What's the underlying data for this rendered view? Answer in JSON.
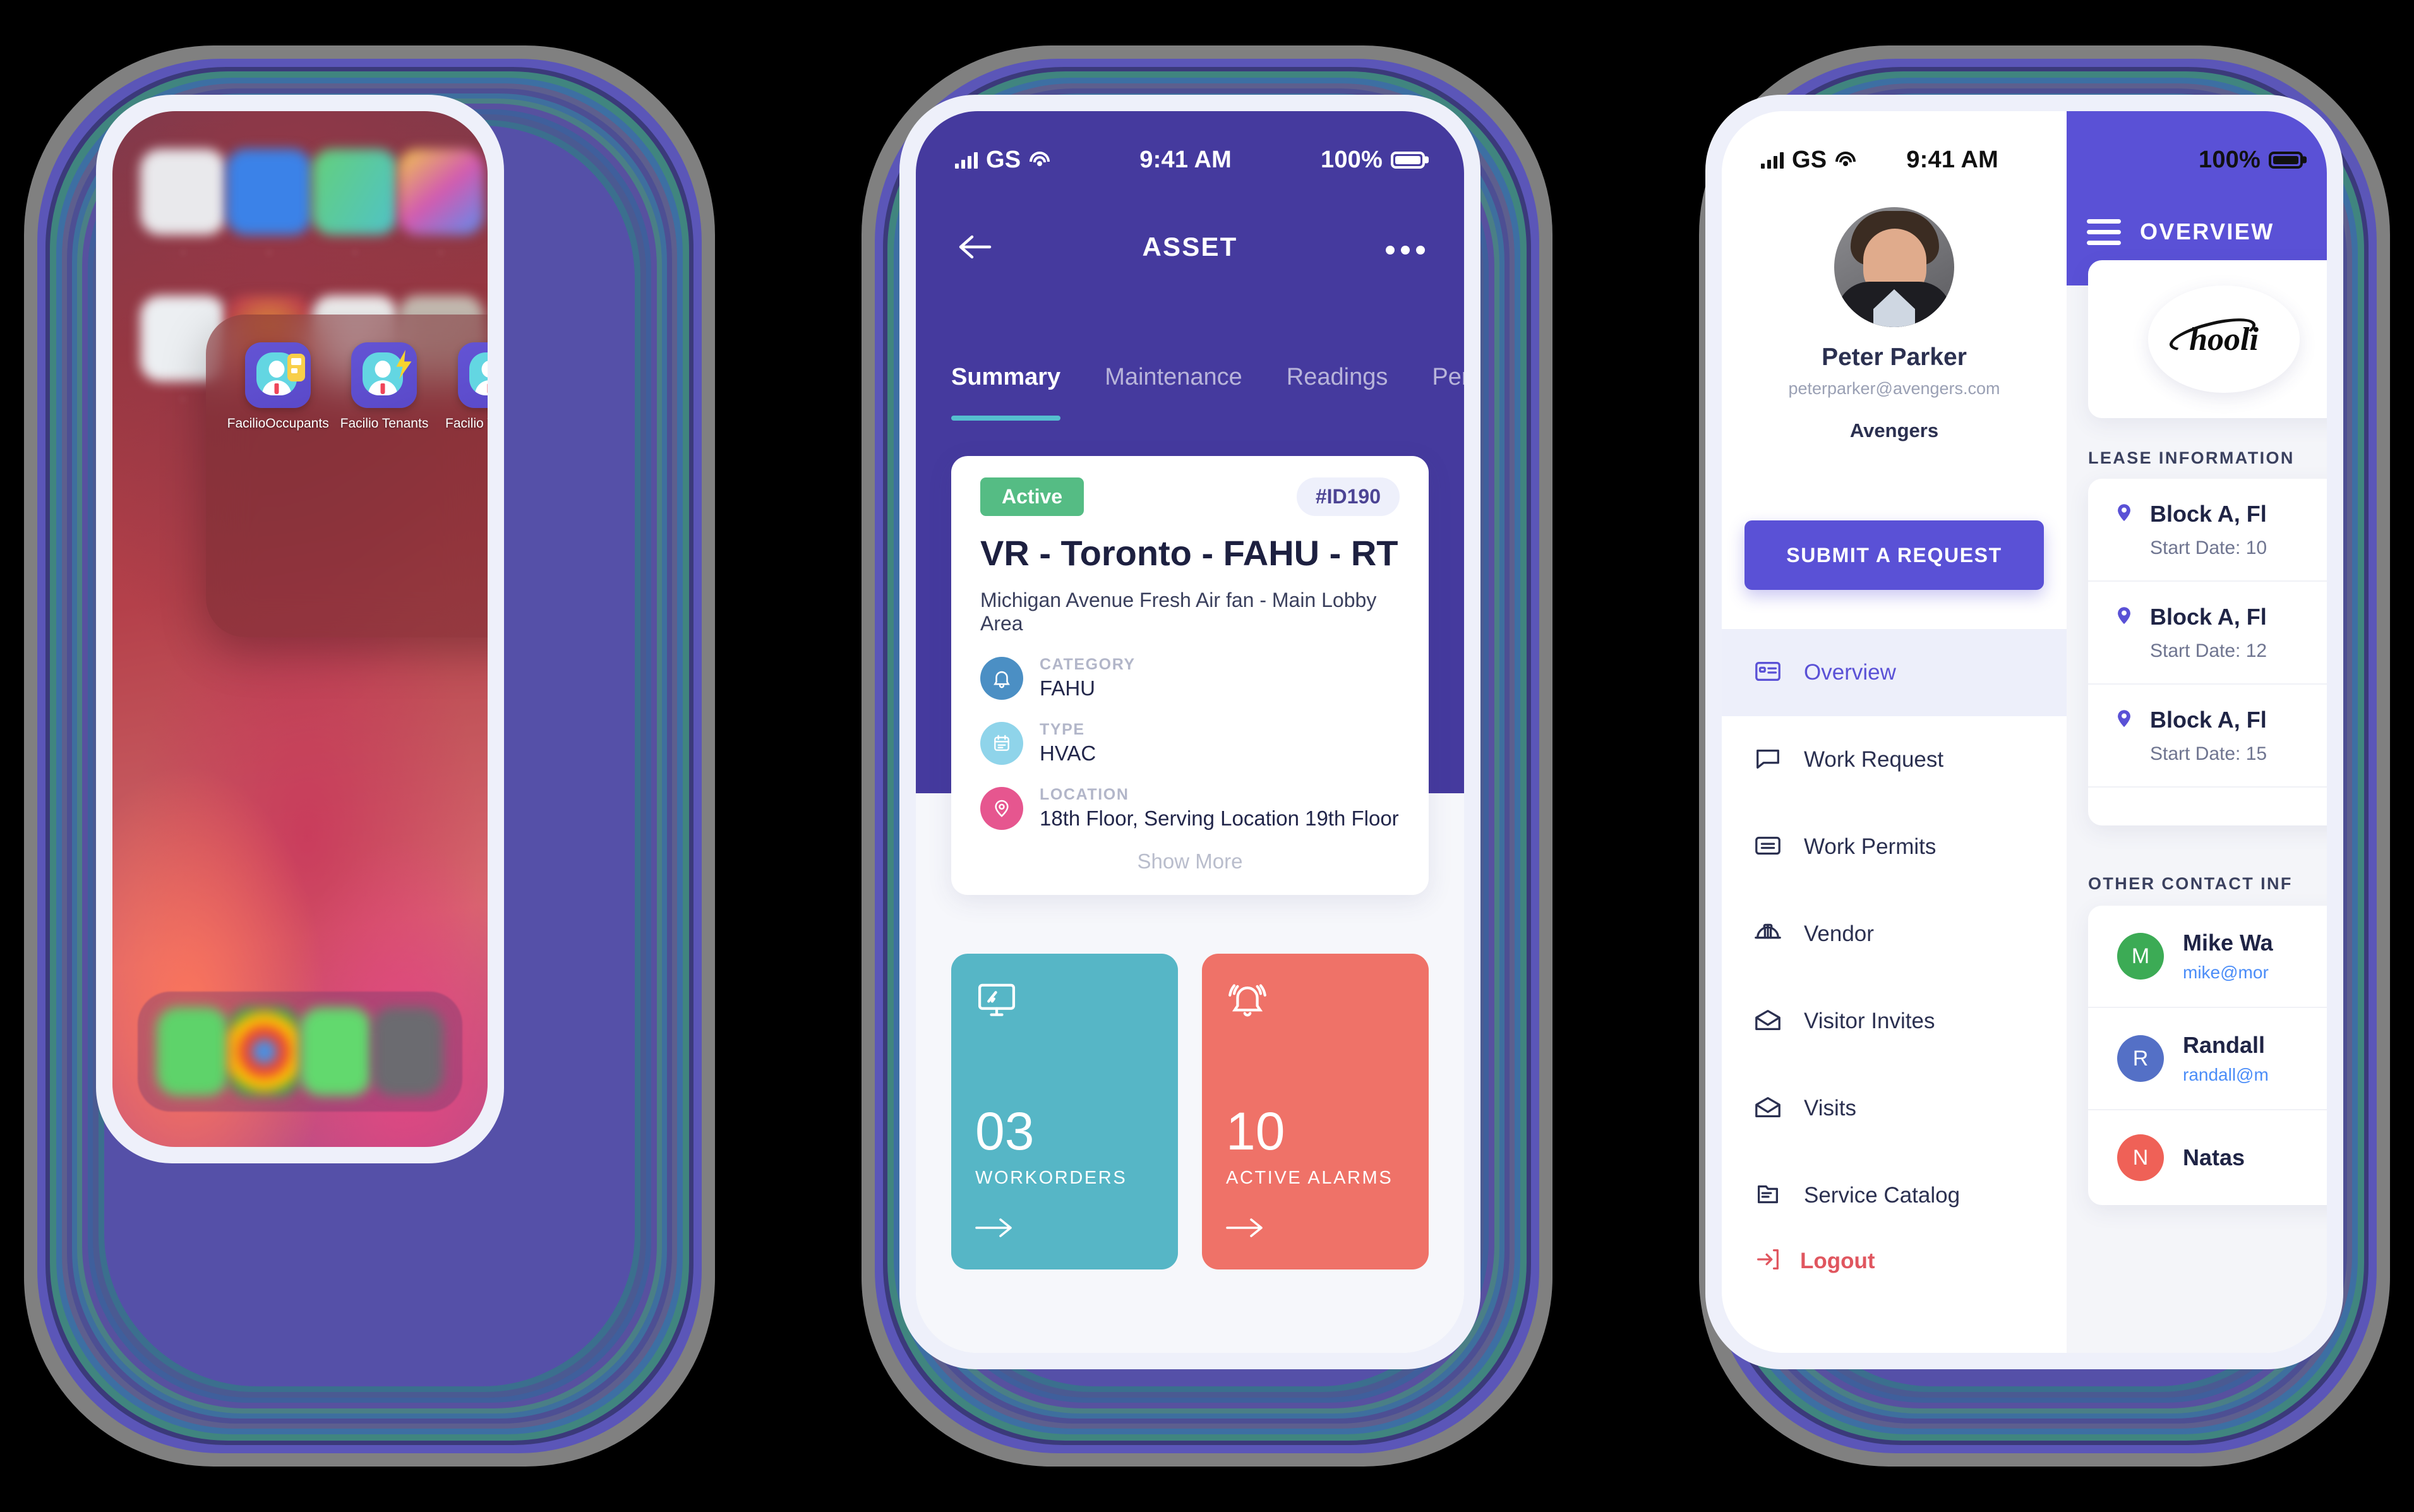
{
  "theme": {
    "purple": "#453a9e",
    "indigo": "#5a51d6",
    "teal": "#56b6c6",
    "salmon": "#ef7268",
    "green": "#55bc84",
    "red": "#e0565f",
    "ring_colors": [
      "#808080",
      "#5b56b8",
      "#40857f",
      "#3d6fa3",
      "#5d5f8e",
      "#4d4f93",
      "#3e6f9e",
      "#4a7f86",
      "#57519f",
      "#3f5f9c",
      "#4a5a92",
      "#3b6f8e",
      "#5550a8"
    ]
  },
  "phone1": {
    "wallpaper_label": "abstract-red-gradient-wallpaper",
    "folder": {
      "apps": [
        {
          "label": "FacilioOccupants",
          "icon": "facilio-occupants-icon",
          "badge": "yellow-card-badge"
        },
        {
          "label": "Facilio Tenants",
          "icon": "facilio-tenants-icon",
          "badge": "yellow-bolt-badge"
        },
        {
          "label": "Facilio Vendors",
          "icon": "facilio-vendors-icon",
          "badge": "pink-tag-badge"
        }
      ]
    },
    "home_icons": [
      {
        "name": "app-icon-1",
        "color": "#e9e9ec"
      },
      {
        "name": "app-icon-2",
        "color": "#3b82e8"
      },
      {
        "name": "app-icon-3",
        "color": "#64d07a"
      },
      {
        "name": "app-icon-4",
        "color": "#d25bb0"
      },
      {
        "name": "app-icon-5",
        "color": "#eceff2"
      },
      {
        "name": "app-icon-6",
        "color": "#c2434e"
      },
      {
        "name": "app-icon-7",
        "color": "#f2f2f2"
      },
      {
        "name": "app-icon-8",
        "color": "#c9bfb5"
      }
    ],
    "dock_icons": [
      {
        "name": "phone-icon",
        "color": "#5ed36a"
      },
      {
        "name": "chrome-icon",
        "color": "#f6f6f6"
      },
      {
        "name": "messages-icon",
        "color": "#62d96e"
      },
      {
        "name": "camera-icon",
        "color": "#6b6b70"
      }
    ]
  },
  "phone2": {
    "status": {
      "carrier": "GS",
      "time": "9:41 AM",
      "battery": "100%"
    },
    "nav": {
      "back_icon": "back-arrow-icon",
      "title": "ASSET",
      "more_icon": "more-dots-icon"
    },
    "tabs": [
      {
        "label": "Summary",
        "active": true
      },
      {
        "label": "Maintenance",
        "active": false
      },
      {
        "label": "Readings",
        "active": false
      },
      {
        "label": "Perfo",
        "active": false
      }
    ],
    "asset": {
      "status_label": "Active",
      "id_label": "#ID190",
      "title": "VR - Toronto - FAHU - RT",
      "subtitle": "Michigan Avenue Fresh Air fan - Main Lobby Area",
      "fields": [
        {
          "key": "CATEGORY",
          "value": "FAHU",
          "icon": "bell-icon"
        },
        {
          "key": "TYPE",
          "value": "HVAC",
          "icon": "calendar-icon"
        },
        {
          "key": "LOCATION",
          "value": "18th Floor, Serving Location 19th Floor",
          "icon": "location-pin-icon"
        }
      ],
      "show_more": "Show More"
    },
    "stats": [
      {
        "icon": "monitor-icon",
        "value": "03",
        "label": "WORKORDERS",
        "arrow": "right-arrow-icon",
        "color": "#56b6c6"
      },
      {
        "icon": "alarm-bell-icon",
        "value": "10",
        "label": "ACTIVE ALARMS",
        "arrow": "right-arrow-icon",
        "color": "#ef7268"
      }
    ]
  },
  "phone3": {
    "status": {
      "carrier": "GS",
      "time": "9:41 AM",
      "battery": "100%"
    },
    "profile": {
      "name": "Peter Parker",
      "email": "peterparker@avengers.com",
      "org": "Avengers",
      "avatar": "user-avatar-photo"
    },
    "submit_button": "SUBMIT A REQUEST",
    "menu": [
      {
        "label": "Overview",
        "icon": "id-card-icon",
        "active": true
      },
      {
        "label": "Work Request",
        "icon": "chat-bubble-icon",
        "active": false
      },
      {
        "label": "Work Permits",
        "icon": "permit-card-icon",
        "active": false
      },
      {
        "label": "Vendor",
        "icon": "hard-hat-icon",
        "active": false
      },
      {
        "label": "Visitor Invites",
        "icon": "envelope-open-icon",
        "active": false
      },
      {
        "label": "Visits",
        "icon": "envelope-open-icon",
        "active": false
      },
      {
        "label": "Service Catalog",
        "icon": "folder-list-icon",
        "active": false
      }
    ],
    "logout": {
      "label": "Logout",
      "icon": "logout-arrow-icon"
    },
    "overview": {
      "menu_icon": "hamburger-menu-icon",
      "title": "OVERVIEW",
      "logo_text": "hooli",
      "lease_heading": "LEASE INFORMATION",
      "lease_rows": [
        {
          "title": "Block A, Fl",
          "sub": "Start Date: 10",
          "icon": "location-pin-icon"
        },
        {
          "title": "Block A, Fl",
          "sub": "Start Date: 12",
          "icon": "location-pin-icon"
        },
        {
          "title": "Block A, Fl",
          "sub": "Start Date: 15",
          "icon": "location-pin-icon"
        }
      ],
      "contact_heading": "OTHER CONTACT INF",
      "contacts": [
        {
          "initial": "M",
          "name": "Mike Wa",
          "email": "mike@mor",
          "color": "#3cab55"
        },
        {
          "initial": "R",
          "name": "Randall ",
          "email": "randall@m",
          "color": "#5470c6"
        },
        {
          "initial": "N",
          "name": "Natas",
          "email": "",
          "color": "#ef6157"
        }
      ]
    }
  }
}
